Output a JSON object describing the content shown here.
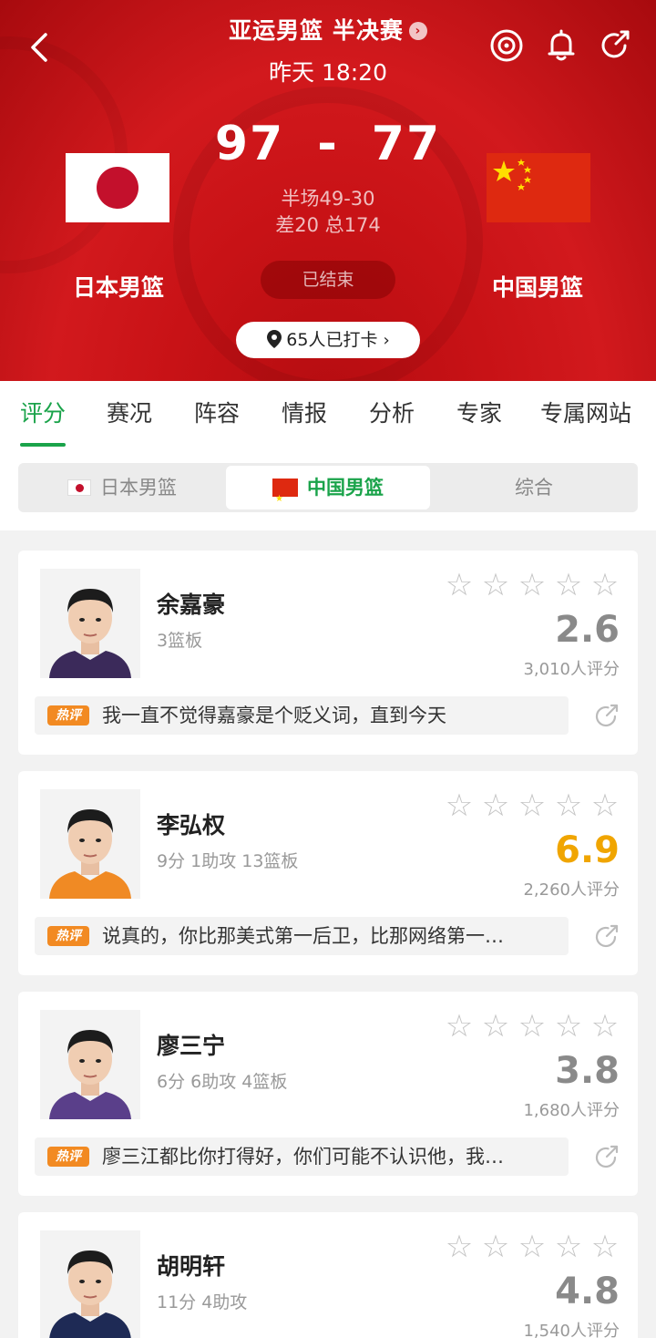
{
  "header": {
    "league_title": "亚运男篮 半决赛",
    "time": "昨天 18:20",
    "home_score": "97",
    "away_score": "77",
    "score_separator": "-",
    "halftime": "半场49-30",
    "diff_total": "差20 总174",
    "home_team": "日本男篮",
    "away_team": "中国男篮",
    "status": "已结束",
    "checkin": "65人已打卡",
    "icons": [
      "back-icon",
      "target-icon",
      "bell-icon",
      "share-icon"
    ],
    "accent_color": "#c8161b"
  },
  "tabs": [
    {
      "label": "评分",
      "active": true
    },
    {
      "label": "赛况"
    },
    {
      "label": "阵容"
    },
    {
      "label": "情报"
    },
    {
      "label": "分析"
    },
    {
      "label": "专家"
    },
    {
      "label": "专属网站"
    }
  ],
  "segments": [
    {
      "label": "日本男篮"
    },
    {
      "label": "中国男篮",
      "active": true
    },
    {
      "label": "综合"
    }
  ],
  "players": [
    {
      "name": "余嘉豪",
      "stats": "3篮板",
      "rating": "2.6",
      "votes": "3,010人评分",
      "hot_label": "热评",
      "comment": "我一直不觉得嘉豪是个贬义词，直到今天",
      "jersey_color": "#3b2a5a"
    },
    {
      "name": "李弘权",
      "stats": "9分 1助攻 13篮板",
      "rating": "6.9",
      "votes": "2,260人评分",
      "hot_label": "热评",
      "comment": "说真的，你比那美式第一后卫，比那网络第一…",
      "jersey_color": "#f08a24"
    },
    {
      "name": "廖三宁",
      "stats": "6分 6助攻 4篮板",
      "rating": "3.8",
      "votes": "1,680人评分",
      "hot_label": "热评",
      "comment": "廖三江都比你打得好，你们可能不认识他，我…",
      "jersey_color": "#5a3f8a"
    },
    {
      "name": "胡明轩",
      "stats": "11分 4助攻",
      "rating": "4.8",
      "votes": "1,540人评分",
      "jersey_color": "#1e2a55"
    }
  ]
}
